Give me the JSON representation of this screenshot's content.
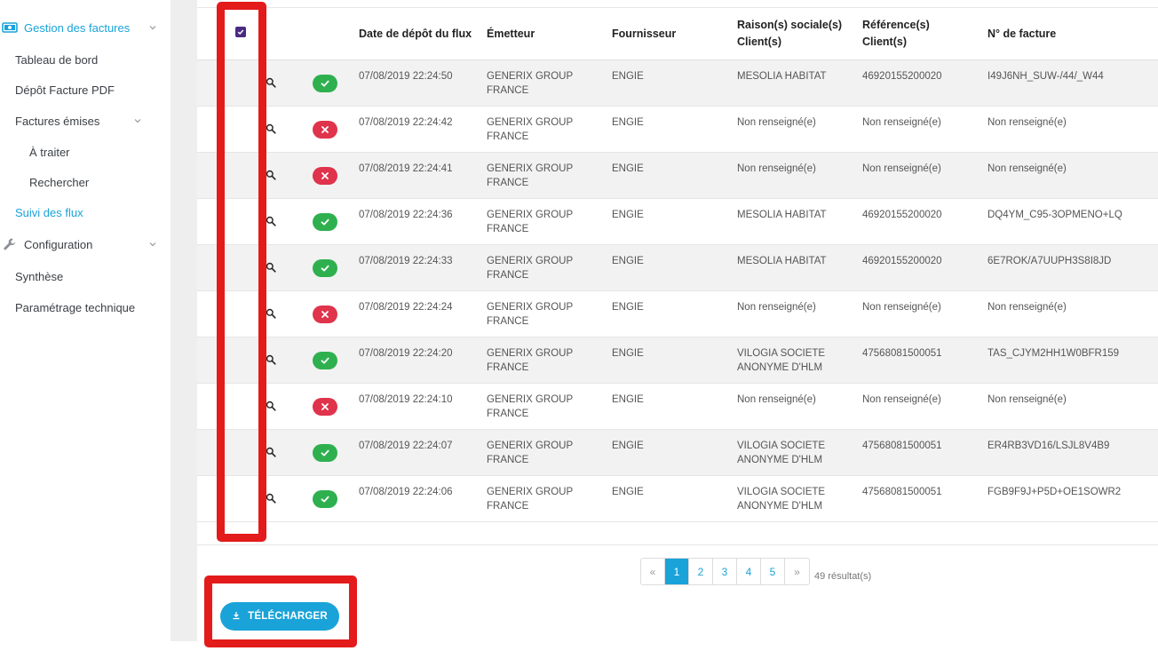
{
  "sidebar": {
    "items": [
      {
        "label": "Gestion des factures",
        "active": true,
        "icon": "invoice-icon",
        "chevron": true
      },
      {
        "label": "Tableau de bord"
      },
      {
        "label": "Dépôt Facture PDF"
      },
      {
        "label": "Factures émises",
        "chevron": true
      },
      {
        "label": "À traiter"
      },
      {
        "label": "Rechercher"
      },
      {
        "label": "Suivi des flux",
        "active": true
      },
      {
        "label": "Configuration",
        "icon": "wrench-icon",
        "chevron": true
      },
      {
        "label": "Synthèse"
      },
      {
        "label": "Paramétrage technique"
      }
    ]
  },
  "table": {
    "headers": {
      "date": "Date de dépôt du flux",
      "emetteur": "Émetteur",
      "fournisseur": "Fournisseur",
      "raison_l1": "Raison(s) sociale(s)",
      "raison_l2": "Client(s)",
      "ref_l1": "Référence(s)",
      "ref_l2": "Client(s)",
      "facture": "N° de facture"
    },
    "rows": [
      {
        "status": "ok",
        "date": "07/08/2019 22:24:50",
        "emetteur_l1": "GENERIX GROUP",
        "emetteur_l2": "FRANCE",
        "fournisseur": "ENGIE",
        "raison_l1": "MESOLIA HABITAT",
        "raison_l2": "",
        "reference": "46920155200020",
        "facture": "I49J6NH_SUW-/44/_W44"
      },
      {
        "status": "err",
        "date": "07/08/2019 22:24:42",
        "emetteur_l1": "GENERIX GROUP",
        "emetteur_l2": "FRANCE",
        "fournisseur": "ENGIE",
        "raison_l1": "Non renseigné(e)",
        "raison_l2": "",
        "reference": "Non renseigné(e)",
        "facture": "Non renseigné(e)"
      },
      {
        "status": "err",
        "date": "07/08/2019 22:24:41",
        "emetteur_l1": "GENERIX GROUP",
        "emetteur_l2": "FRANCE",
        "fournisseur": "ENGIE",
        "raison_l1": "Non renseigné(e)",
        "raison_l2": "",
        "reference": "Non renseigné(e)",
        "facture": "Non renseigné(e)"
      },
      {
        "status": "ok",
        "date": "07/08/2019 22:24:36",
        "emetteur_l1": "GENERIX GROUP",
        "emetteur_l2": "FRANCE",
        "fournisseur": "ENGIE",
        "raison_l1": "MESOLIA HABITAT",
        "raison_l2": "",
        "reference": "46920155200020",
        "facture": "DQ4YM_C95-3OPMENO+LQ"
      },
      {
        "status": "ok",
        "date": "07/08/2019 22:24:33",
        "emetteur_l1": "GENERIX GROUP",
        "emetteur_l2": "FRANCE",
        "fournisseur": "ENGIE",
        "raison_l1": "MESOLIA HABITAT",
        "raison_l2": "",
        "reference": "46920155200020",
        "facture": "6E7ROK/A7UUPH3S8I8JD"
      },
      {
        "status": "err",
        "date": "07/08/2019 22:24:24",
        "emetteur_l1": "GENERIX GROUP",
        "emetteur_l2": "FRANCE",
        "fournisseur": "ENGIE",
        "raison_l1": "Non renseigné(e)",
        "raison_l2": "",
        "reference": "Non renseigné(e)",
        "facture": "Non renseigné(e)"
      },
      {
        "status": "ok",
        "date": "07/08/2019 22:24:20",
        "emetteur_l1": "GENERIX GROUP",
        "emetteur_l2": "FRANCE",
        "fournisseur": "ENGIE",
        "raison_l1": "VILOGIA SOCIETE",
        "raison_l2": "ANONYME D'HLM",
        "reference": "47568081500051",
        "facture": "TAS_CJYM2HH1W0BFR159"
      },
      {
        "status": "err",
        "date": "07/08/2019 22:24:10",
        "emetteur_l1": "GENERIX GROUP",
        "emetteur_l2": "FRANCE",
        "fournisseur": "ENGIE",
        "raison_l1": "Non renseigné(e)",
        "raison_l2": "",
        "reference": "Non renseigné(e)",
        "facture": "Non renseigné(e)"
      },
      {
        "status": "ok",
        "date": "07/08/2019 22:24:07",
        "emetteur_l1": "GENERIX GROUP",
        "emetteur_l2": "FRANCE",
        "fournisseur": "ENGIE",
        "raison_l1": "VILOGIA SOCIETE",
        "raison_l2": "ANONYME D'HLM",
        "reference": "47568081500051",
        "facture": "ER4RB3VD16/LSJL8V4B9"
      },
      {
        "status": "ok",
        "date": "07/08/2019 22:24:06",
        "emetteur_l1": "GENERIX GROUP",
        "emetteur_l2": "FRANCE",
        "fournisseur": "ENGIE",
        "raison_l1": "VILOGIA SOCIETE",
        "raison_l2": "ANONYME D'HLM",
        "reference": "47568081500051",
        "facture": "FGB9F9J+P5D+OE1SOWR2"
      }
    ]
  },
  "pagination": {
    "prev": "«",
    "pages": [
      "1",
      "2",
      "3",
      "4",
      "5"
    ],
    "current": "1",
    "next": "»",
    "results": "49 résultat(s)"
  },
  "download_button": {
    "label": "TÉLÉCHARGER",
    "icon": "download-icon"
  },
  "colors": {
    "accent": "#1aa3d9",
    "success": "#2fb04f",
    "error": "#e0334c",
    "checkbox": "#4a2b82",
    "annotation": "#e31b1b"
  }
}
